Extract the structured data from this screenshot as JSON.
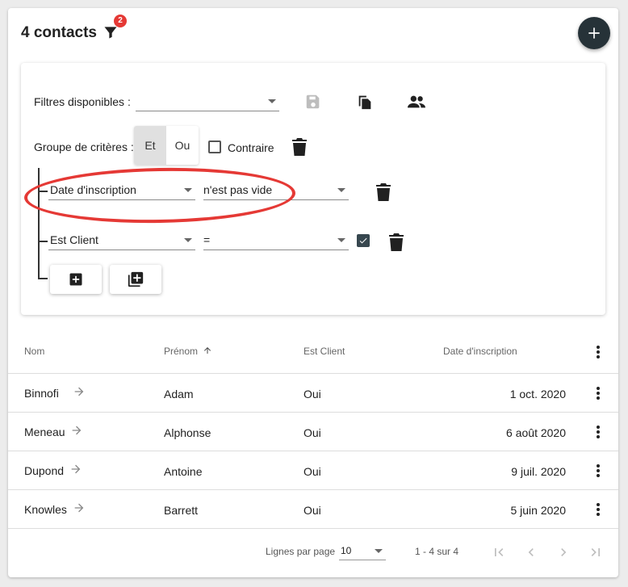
{
  "header": {
    "title": "4 contacts",
    "filter_count": "2"
  },
  "filters": {
    "available_label": "Filtres disponibles :",
    "available_value": "",
    "group_label": "Groupe de critères :",
    "group_and": "Et",
    "group_or": "Ou",
    "contrary_label": "Contraire",
    "contrary_checked": false,
    "criteria": [
      {
        "field": "Date d'inscription",
        "operator": "n'est pas vide",
        "has_value_checkbox": false
      },
      {
        "field": "Est Client",
        "operator": "=",
        "has_value_checkbox": true,
        "value_checked": true
      }
    ]
  },
  "table": {
    "columns": [
      "Nom",
      "Prénom",
      "Est Client",
      "Date d'inscription"
    ],
    "sort": {
      "column": "Prénom",
      "direction": "asc"
    },
    "rows": [
      {
        "nom": "Binnofi",
        "prenom": "Adam",
        "client": "Oui",
        "date": "1 oct. 2020"
      },
      {
        "nom": "Meneau",
        "prenom": "Alphonse",
        "client": "Oui",
        "date": "6 août 2020"
      },
      {
        "nom": "Dupond",
        "prenom": "Antoine",
        "client": "Oui",
        "date": "9 juil. 2020"
      },
      {
        "nom": "Knowles",
        "prenom": "Barrett",
        "client": "Oui",
        "date": "5 juin 2020"
      }
    ]
  },
  "pagination": {
    "rows_per_page_label": "Lignes par page",
    "rows_per_page": "10",
    "range": "1 - 4 sur 4"
  },
  "colors": {
    "fab": "#263238",
    "badge": "#e53935",
    "annotation": "#e53935"
  }
}
